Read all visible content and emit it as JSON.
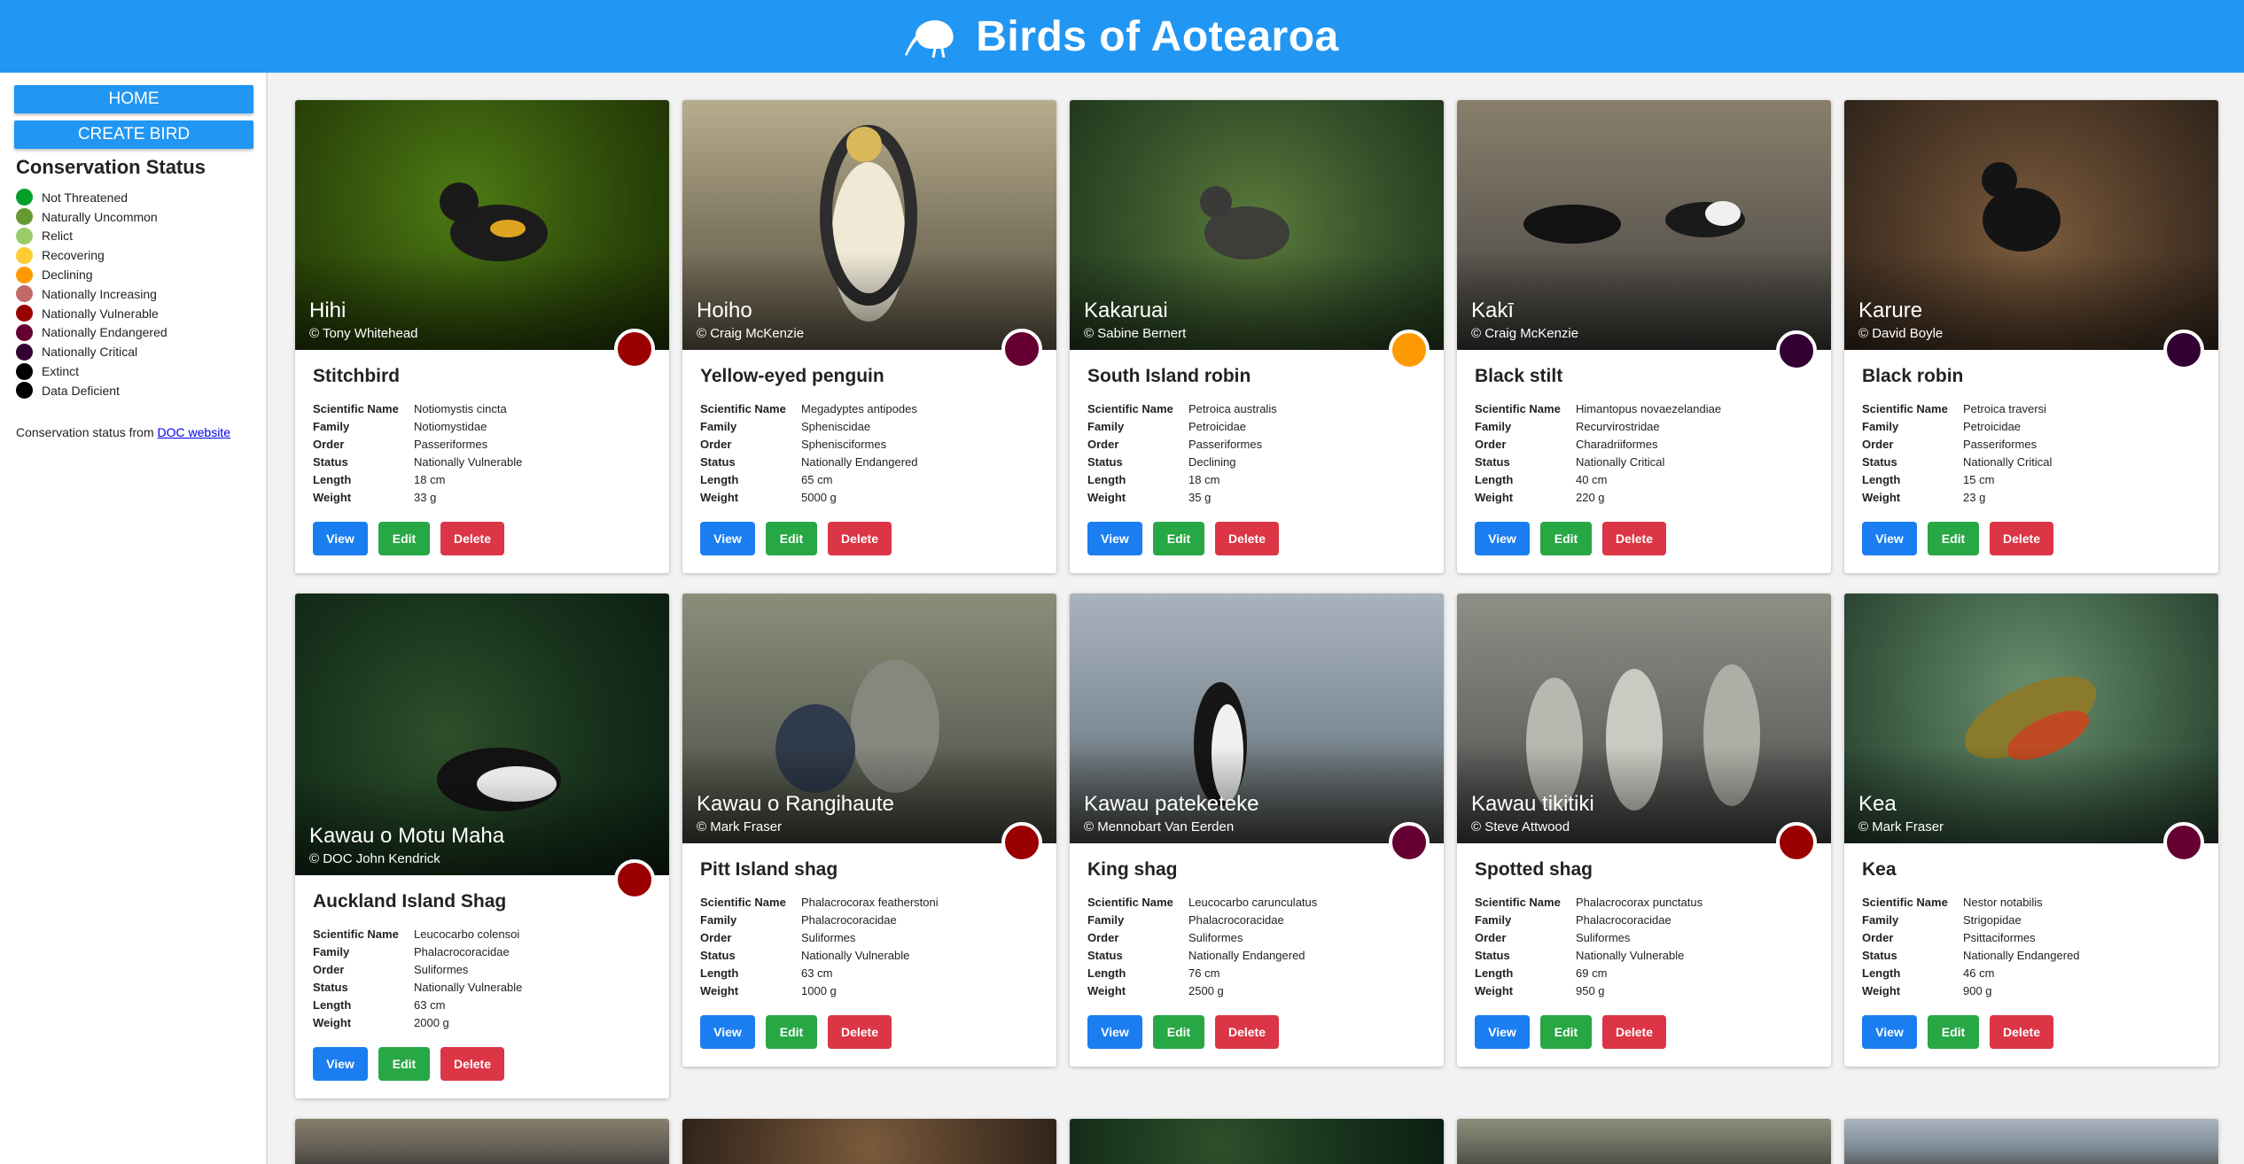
{
  "header": {
    "title": "Birds of Aotearoa",
    "logo_icon": "kiwi-bird-icon"
  },
  "sidebar": {
    "home_label": "HOME",
    "create_label": "CREATE BIRD",
    "legend_title": "Conservation Status",
    "legend": [
      {
        "label": "Not Threatened",
        "color": "#02a028"
      },
      {
        "label": "Naturally Uncommon",
        "color": "#649a31"
      },
      {
        "label": "Relict",
        "color": "#99cb68"
      },
      {
        "label": "Recovering",
        "color": "#fecc33"
      },
      {
        "label": "Declining",
        "color": "#fe9a01"
      },
      {
        "label": "Nationally Increasing",
        "color": "#c26967"
      },
      {
        "label": "Nationally Vulnerable",
        "color": "#9b0000"
      },
      {
        "label": "Nationally Endangered",
        "color": "#660032"
      },
      {
        "label": "Nationally Critical",
        "color": "#320033"
      },
      {
        "label": "Extinct",
        "color": "#000000"
      },
      {
        "label": "Data Deficient",
        "color": "#000000"
      }
    ],
    "source_prefix": "Conservation status from ",
    "source_link": "DOC website"
  },
  "labels": {
    "scientific": "Scientific Name",
    "family": "Family",
    "order": "Order",
    "status": "Status",
    "length": "Length",
    "weight": "Weight",
    "view": "View",
    "edit": "Edit",
    "delete": "Delete"
  },
  "birds": [
    {
      "maori": "Hihi",
      "credit": "© Tony Whitehead",
      "english": "Stitchbird",
      "scientific": "Notiomystis cincta",
      "family": "Notiomystidae",
      "order": "Passeriformes",
      "status": "Nationally Vulnerable",
      "length": "18 cm",
      "weight": "33 g",
      "status_color": "#9b0000"
    },
    {
      "maori": "Hoiho",
      "credit": "© Craig McKenzie",
      "english": "Yellow-eyed penguin",
      "scientific": "Megadyptes antipodes",
      "family": "Spheniscidae",
      "order": "Sphenisciformes",
      "status": "Nationally Endangered",
      "length": "65 cm",
      "weight": "5000 g",
      "status_color": "#660032"
    },
    {
      "maori": "Kakaruai",
      "credit": "© Sabine Bernert",
      "english": "South Island robin",
      "scientific": "Petroica australis",
      "family": "Petroicidae",
      "order": "Passeriformes",
      "status": "Declining",
      "length": "18 cm",
      "weight": "35 g",
      "status_color": "#fe9a01"
    },
    {
      "maori": "Kakī",
      "credit": "© Craig McKenzie",
      "english": "Black stilt",
      "scientific": "Himantopus novaezelandiae",
      "family": "Recurvirostridae",
      "order": "Charadriiformes",
      "status": "Nationally Critical",
      "length": "40 cm",
      "weight": "220 g",
      "status_color": "#320033"
    },
    {
      "maori": "Karure",
      "credit": "© David Boyle",
      "english": "Black robin",
      "scientific": "Petroica traversi",
      "family": "Petroicidae",
      "order": "Passeriformes",
      "status": "Nationally Critical",
      "length": "15 cm",
      "weight": "23 g",
      "status_color": "#320033"
    },
    {
      "maori": "Kawau o Motu Maha",
      "credit": "© DOC John Kendrick",
      "english": "Auckland Island Shag",
      "scientific": "Leucocarbo colensoi",
      "family": "Phalacrocoracidae",
      "order": "Suliformes",
      "status": "Nationally Vulnerable",
      "length": "63 cm",
      "weight": "2000 g",
      "status_color": "#9b0000"
    },
    {
      "maori": "Kawau o Rangihaute",
      "credit": "© Mark Fraser",
      "english": "Pitt Island shag",
      "scientific": "Phalacrocorax featherstoni",
      "family": "Phalacrocoracidae",
      "order": "Suliformes",
      "status": "Nationally Vulnerable",
      "length": "63 cm",
      "weight": "1000 g",
      "status_color": "#9b0000"
    },
    {
      "maori": "Kawau pateketeke",
      "credit": "© Mennobart Van Eerden",
      "english": "King shag",
      "scientific": "Leucocarbo carunculatus",
      "family": "Phalacrocoracidae",
      "order": "Suliformes",
      "status": "Nationally Endangered",
      "length": "76 cm",
      "weight": "2500 g",
      "status_color": "#660032"
    },
    {
      "maori": "Kawau tikitiki",
      "credit": "© Steve Attwood",
      "english": "Spotted shag",
      "scientific": "Phalacrocorax punctatus",
      "family": "Phalacrocoracidae",
      "order": "Suliformes",
      "status": "Nationally Vulnerable",
      "length": "69 cm",
      "weight": "950 g",
      "status_color": "#9b0000"
    },
    {
      "maori": "Kea",
      "credit": "© Mark Fraser",
      "english": "Kea",
      "scientific": "Nestor notabilis",
      "family": "Strigopidae",
      "order": "Psittaciformes",
      "status": "Nationally Endangered",
      "length": "46 cm",
      "weight": "900 g",
      "status_color": "#660032"
    }
  ]
}
